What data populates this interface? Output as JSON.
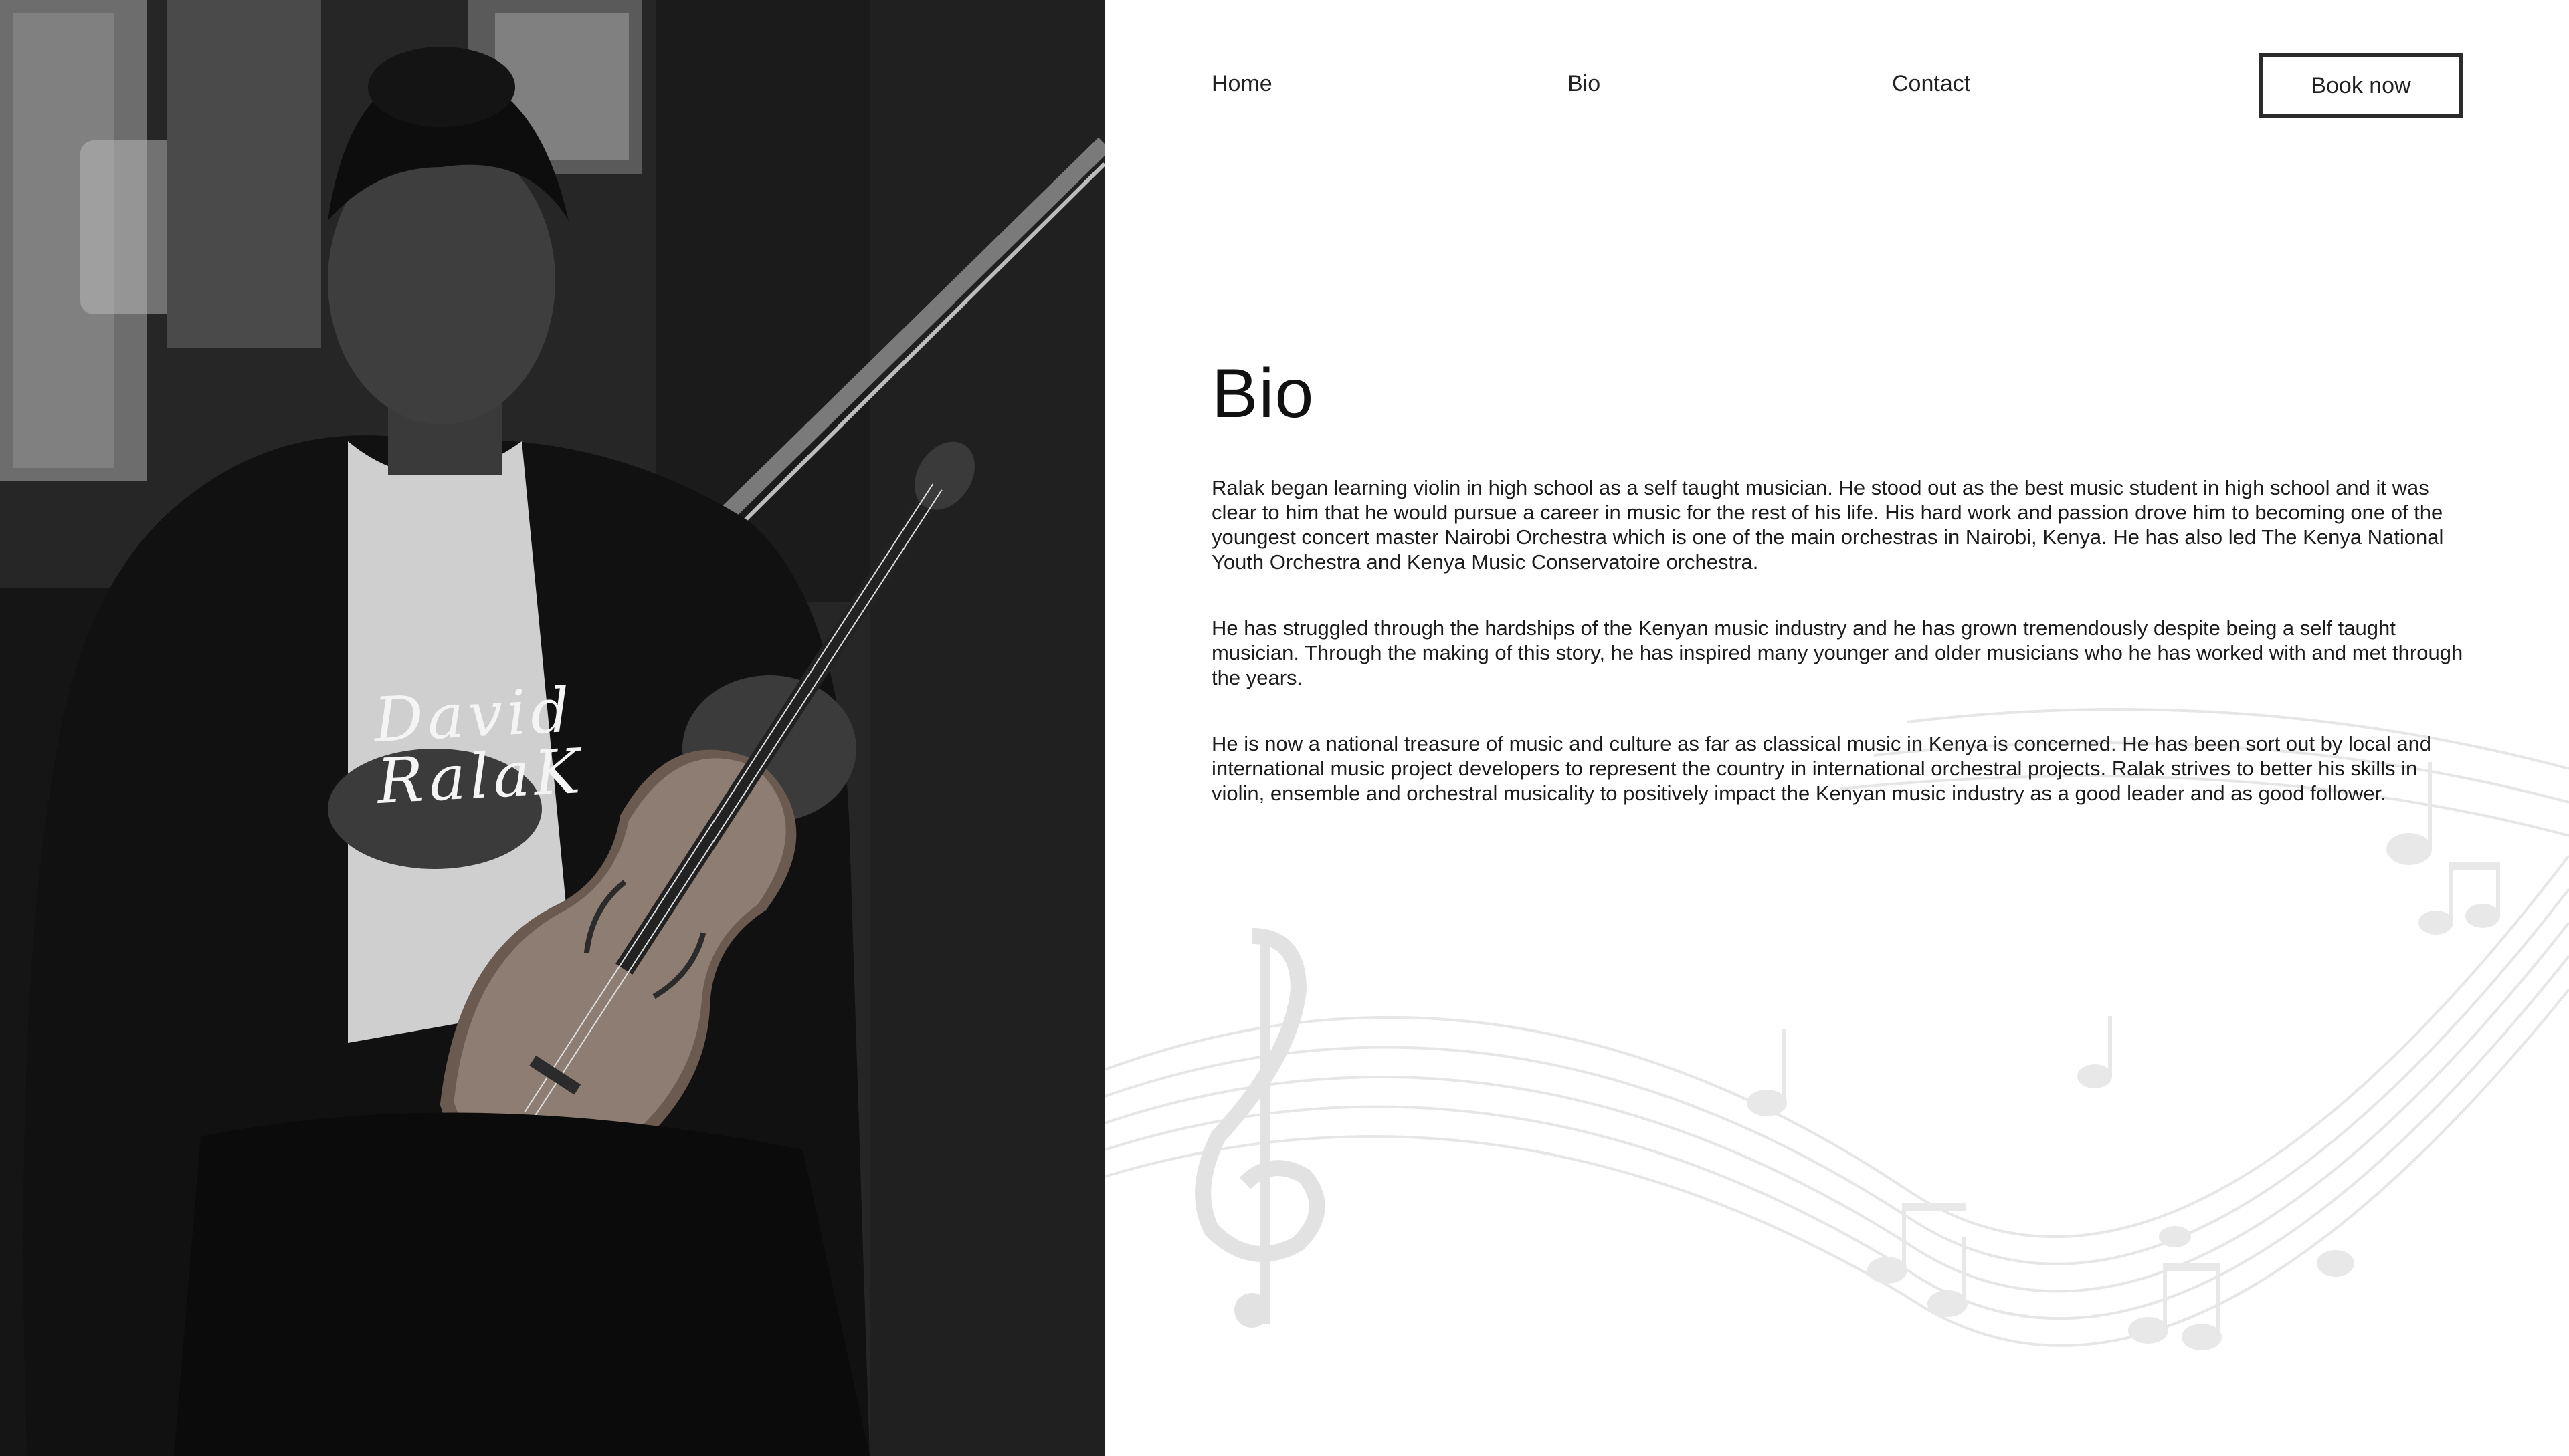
{
  "hero": {
    "signature": "David RalaK",
    "photo": "black-and-white portrait of violinist holding violin and bow"
  },
  "nav": {
    "home": "Home",
    "bio": "Bio",
    "contact": "Contact",
    "book": "Book now"
  },
  "bio": {
    "title": "Bio",
    "paragraphs": [
      "Ralak began learning violin in high school as a self taught musician. He stood out as the best music student in high school and it was clear to him that he would pursue a career in music for the rest of his life. His hard work and passion drove him to becoming one of the youngest concert master Nairobi Orchestra which is one of the main orchestras in Nairobi, Kenya. He has also led The Kenya National Youth Orchestra and Kenya Music Conservatoire orchestra.",
      "He has struggled through the hardships of the Kenyan music industry and he has grown tremendously despite being a self taught musician. Through the making of this story, he has inspired many younger and older musicians who he has worked with and met through the years.",
      "He is now a national treasure of music and culture as far as classical music in Kenya is concerned. He has been sort out by local and international music project developers to represent the country in international orchestral projects. Ralak strives to better his skills in violin, ensemble and orchestral musicality to positively impact the Kenyan music industry as a good leader and as good follower."
    ]
  },
  "colors": {
    "text": "#1c1c1c",
    "background": "#ffffff",
    "button_border": "#2b2b2b",
    "decor": "#e6e6e6"
  }
}
